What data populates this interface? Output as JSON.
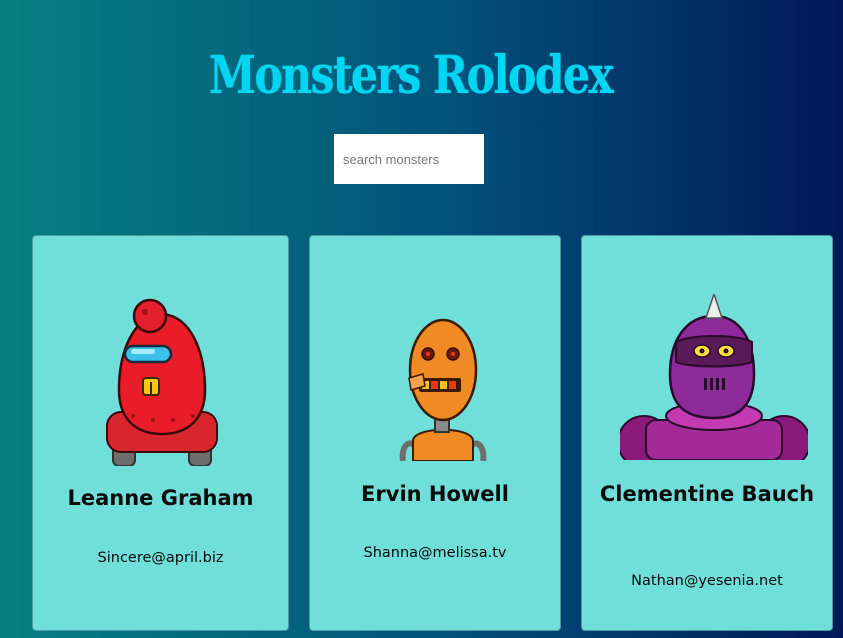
{
  "app": {
    "title": "Monsters Rolodex"
  },
  "search": {
    "placeholder": "search monsters",
    "value": ""
  },
  "monsters": [
    {
      "name": "Leanne Graham",
      "email": "Sincere@april.biz",
      "avatar": "red-robot-monster"
    },
    {
      "name": "Ervin Howell",
      "email": "Shanna@melissa.tv",
      "avatar": "orange-robot-monster"
    },
    {
      "name": "Clementine Bauch",
      "email": "Nathan@yesenia.net",
      "avatar": "purple-robot-monster"
    }
  ],
  "colors": {
    "title": "#00d5f2",
    "card_background": "#70dfda",
    "gradient_start": "#058180",
    "gradient_end": "#011858"
  }
}
